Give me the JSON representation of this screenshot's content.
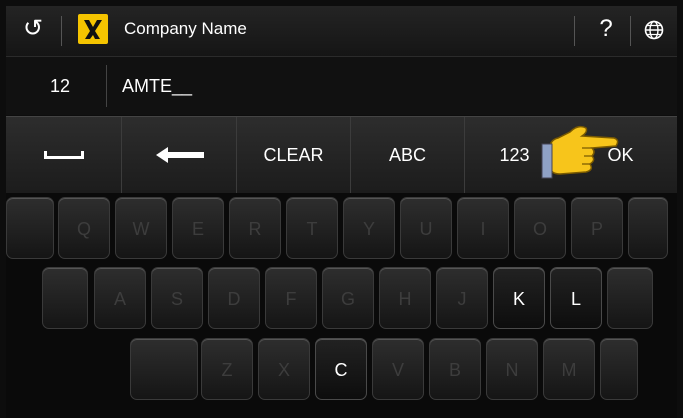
{
  "topbar": {
    "title": "Company Name",
    "help_label": "?"
  },
  "entry": {
    "count": "12",
    "value": "AMTE__"
  },
  "function_row": {
    "clear_label": "CLEAR",
    "abc_label": "ABC",
    "num_label": "123",
    "ok_label": "OK"
  },
  "keyboard": {
    "row1": [
      "",
      "Q",
      "W",
      "E",
      "R",
      "T",
      "Y",
      "U",
      "I",
      "O",
      "P",
      ""
    ],
    "row2": [
      "",
      "A",
      "S",
      "D",
      "F",
      "G",
      "H",
      "J",
      "K",
      "L",
      ""
    ],
    "row3": [
      "",
      "Z",
      "X",
      "C",
      "V",
      "B",
      "N",
      "M",
      ""
    ],
    "active_keys": [
      "K",
      "L",
      "C"
    ]
  },
  "colors": {
    "logo_yellow": "#f5c400",
    "hand_yellow": "#f7c51b",
    "background": "#0d0d0d"
  },
  "icons": [
    "back-arrow-icon",
    "yellow-pages-logo-icon",
    "help-icon",
    "globe-icon",
    "space-icon",
    "backspace-arrow-icon",
    "pointing-hand-icon"
  ]
}
